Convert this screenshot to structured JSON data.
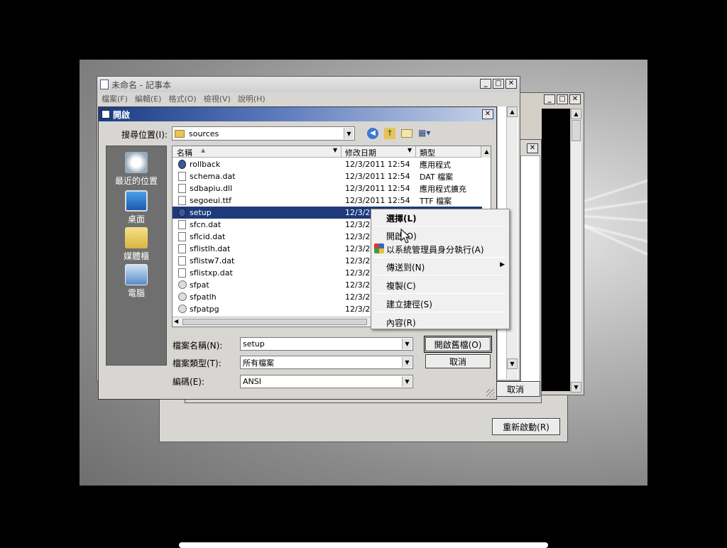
{
  "notepad": {
    "title": "未命名 - 記事本",
    "menu": [
      "檔案(F)",
      "編輯(E)",
      "格式(O)",
      "檢視(V)",
      "說明(H)"
    ]
  },
  "back_window": {
    "cancel_label": "取消",
    "restart_label": "重新啟動(R)"
  },
  "open_dialog": {
    "title": "開啟",
    "lookin_label": "搜尋位置(I):",
    "lookin_value": "sources",
    "columns": {
      "name": "名稱",
      "date": "修改日期",
      "type": "類型"
    },
    "places": [
      "最近的位置",
      "桌面",
      "媒體櫃",
      "電腦"
    ],
    "files": [
      {
        "name": "rollback",
        "date": "12/3/2011 12:54",
        "type": "應用程式",
        "icon": "app-icon"
      },
      {
        "name": "schema.dat",
        "date": "12/3/2011 12:54",
        "type": "DAT 檔案",
        "icon": "file-icon"
      },
      {
        "name": "sdbapiu.dll",
        "date": "12/3/2011 12:54",
        "type": "應用程式擴充",
        "icon": "dll-icon"
      },
      {
        "name": "segoeui.ttf",
        "date": "12/3/2011 12:54",
        "type": "TTF 檔案",
        "icon": "file-icon"
      },
      {
        "name": "setup",
        "date": "12/3/20",
        "type": "",
        "icon": "app-icon"
      },
      {
        "name": "sfcn.dat",
        "date": "12/3/20",
        "type": "",
        "icon": "file-icon"
      },
      {
        "name": "sflcid.dat",
        "date": "12/3/20",
        "type": "",
        "icon": "file-icon"
      },
      {
        "name": "sflistlh.dat",
        "date": "12/3/20",
        "type": "",
        "icon": "file-icon"
      },
      {
        "name": "sflistw7.dat",
        "date": "12/3/20",
        "type": "",
        "icon": "file-icon"
      },
      {
        "name": "sflistxp.dat",
        "date": "12/3/20",
        "type": "",
        "icon": "file-icon"
      },
      {
        "name": "sfpat",
        "date": "12/3/20",
        "type": "",
        "icon": "gear-icon"
      },
      {
        "name": "sfpatlh",
        "date": "12/3/20",
        "type": "",
        "icon": "gear-icon"
      },
      {
        "name": "sfpatpg",
        "date": "12/3/20",
        "type": "",
        "icon": "gear-icon"
      }
    ],
    "filename_label": "檔案名稱(N):",
    "filename_value": "setup",
    "filetype_label": "檔案類型(T):",
    "filetype_value": "所有檔案",
    "encoding_label": "編碼(E):",
    "encoding_value": "ANSI",
    "open_button": "開啟舊檔(O)",
    "cancel_button": "取消"
  },
  "context_menu": {
    "select": "選擇(L)",
    "open": "開啟(O)",
    "run_as_admin": "以系統管理員身分執行(A)",
    "send_to": "傳送到(N)",
    "copy": "複製(C)",
    "create_shortcut": "建立捷徑(S)",
    "properties": "內容(R)"
  },
  "colors": {
    "selection": "#1e3a7a",
    "dialog_title": "#1a3c82",
    "places_bg": "#6f6f6f"
  }
}
